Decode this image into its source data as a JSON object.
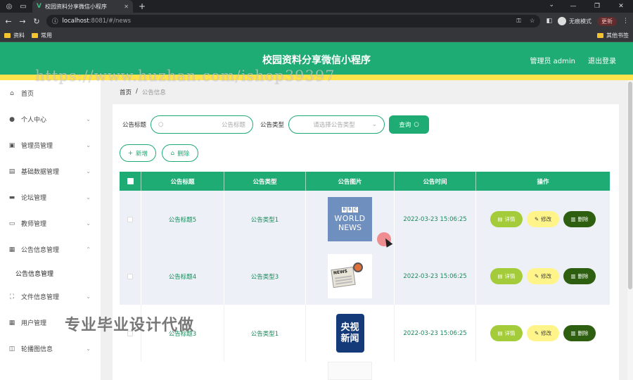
{
  "browser": {
    "tab_title": "校园资料分享微信小程序",
    "url_host": "localhost",
    "url_path": ":8081/#/news",
    "profile_label": "无痕模式",
    "update_label": "更新",
    "bookmarks": [
      "资料",
      "常用"
    ],
    "other_bookmarks": "其他书签"
  },
  "header": {
    "title": "校园资料分享微信小程序",
    "admin_label": "管理员 admin",
    "logout_label": "退出登录",
    "watermark": "https://www.huzhan.com/ishop39397"
  },
  "sidebar": {
    "items": [
      {
        "label": "首页",
        "icon": "home-icon"
      },
      {
        "label": "个人中心",
        "icon": "user-icon"
      },
      {
        "label": "管理员管理",
        "icon": "admin-icon"
      },
      {
        "label": "基础数据管理",
        "icon": "data-icon"
      },
      {
        "label": "论坛管理",
        "icon": "forum-icon"
      },
      {
        "label": "教师管理",
        "icon": "teacher-icon"
      },
      {
        "label": "公告信息管理",
        "icon": "notice-icon"
      },
      {
        "label": "文件信息管理",
        "icon": "file-icon"
      },
      {
        "label": "用户管理",
        "icon": "users-icon"
      },
      {
        "label": "轮播图信息",
        "icon": "carousel-icon"
      }
    ],
    "submenu_label": "公告信息管理"
  },
  "promo_text": "专业毕业设计代做",
  "breadcrumb": {
    "home": "首页",
    "sep": "/",
    "current": "公告信息"
  },
  "search": {
    "title_label": "公告标题",
    "title_placeholder": "公告标题",
    "type_label": "公告类型",
    "type_placeholder": "请选择公告类型",
    "query_label": "查询"
  },
  "ops": {
    "add_label": "新增",
    "delete_label": "删除"
  },
  "table": {
    "columns": [
      "公告标题",
      "公告类型",
      "公告图片",
      "公告时间",
      "操作"
    ],
    "rows": [
      {
        "title": "公告标题5",
        "type": "公告类型1",
        "time": "2022-03-23 15:06:25",
        "image": "bbc-world-news"
      },
      {
        "title": "公告标题4",
        "type": "公告类型3",
        "time": "2022-03-23 15:06:25",
        "image": "newspaper-mic"
      },
      {
        "title": "公告标题3",
        "type": "公告类型1",
        "time": "2022-03-23 15:06:25",
        "image": "cctv-news"
      }
    ],
    "action_labels": {
      "detail": "详情",
      "edit": "修改",
      "delete": "删除"
    }
  },
  "bbc_image": {
    "letters": [
      "B",
      "B",
      "C"
    ],
    "line1": "WORLD",
    "line2": "NEWS"
  },
  "cctv_image": {
    "line1": "央视",
    "line2": "新闻"
  },
  "news_image": {
    "label": "NEWS"
  },
  "colors": {
    "accent": "#1fab74",
    "yellow": "#ffe34d",
    "detail": "#a4cc3a",
    "edit": "#fff48a",
    "delete": "#2e5f10"
  }
}
